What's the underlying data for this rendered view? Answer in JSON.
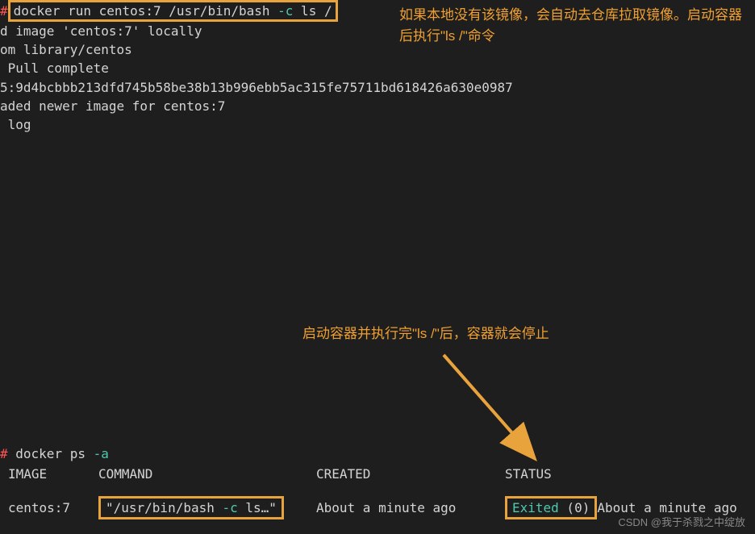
{
  "top_command": {
    "prompt": "#",
    "cmd_part1": " docker run centos:7 /usr/bin/bash ",
    "flag": "-c",
    "cmd_part2": " ls / "
  },
  "output_lines": {
    "line1": "d image 'centos:7' locally",
    "line2": "om library/centos",
    "line3": " Pull complete",
    "line4": "5:9d4bcbbb213dfd745b58be38b13b996ebb5ac315fe75711bd618426a630e0987",
    "line5": "aded newer image for centos:7",
    "line6": " log"
  },
  "annotation1": "如果本地没有该镜像，会自动去仓库拉取镜像。启动容器后执行\"ls /\"命令",
  "annotation2": "启动容器并执行完\"ls /\"后，容器就会停止",
  "ps_command": {
    "prompt": "#",
    "cmd": " docker ps ",
    "flag": "-a"
  },
  "ps_headers": {
    "image": " IMAGE",
    "command": "COMMAND",
    "created": "CREATED",
    "status": "STATUS"
  },
  "ps_row": {
    "image": " centos:7",
    "command_part1": "\"/usr/bin/bash ",
    "command_flag": "-c",
    "command_part2": " ls…\"",
    "created": "About a minute ago",
    "status_exited": "Exited",
    "status_code": " (0) ",
    "status_time": "About a minute ago"
  },
  "watermark": "CSDN @我于杀戮之中绽放"
}
